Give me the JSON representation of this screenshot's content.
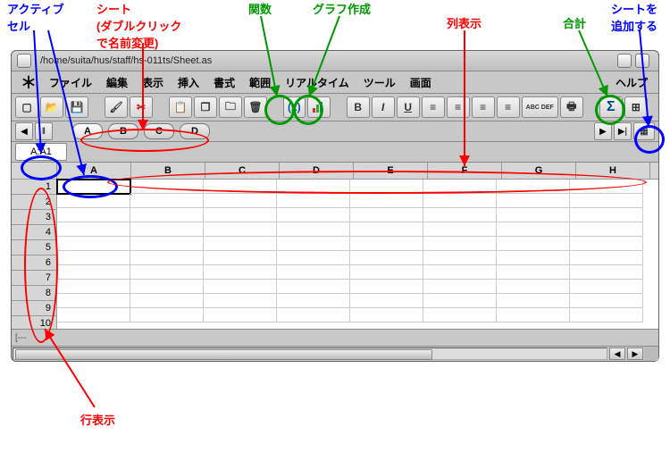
{
  "annotations": {
    "active_cell": "アクティブ\nセル",
    "sheet_rename": "シート\n(ダブルクリック\nで名前変更)",
    "function": "関数",
    "chart": "グラフ作成",
    "col_display": "列表示",
    "sum": "合計",
    "add_sheet": "シートを\n追加する",
    "row_display": "行表示"
  },
  "window": {
    "title": "/home/suita/hus/staff/hs-011ts/Sheet.as"
  },
  "menu": {
    "file": "ファイル",
    "edit": "編集",
    "view": "表示",
    "insert": "挿入",
    "format": "書式",
    "range": "範囲",
    "realtime": "リアルタイム",
    "tool": "ツール",
    "window": "画面",
    "help": "ヘルプ"
  },
  "toolbar": {
    "fx": "(x)",
    "chart": "▮",
    "bold": "B",
    "italic": "I",
    "underline": "U",
    "abc": "ABC\nDEF",
    "sigma": "Σ"
  },
  "sheets": {
    "a": "A",
    "b": "B",
    "c": "C",
    "d": "D"
  },
  "cellref": "A:A1",
  "columns": [
    "A",
    "B",
    "C",
    "D",
    "E",
    "F",
    "G",
    "H"
  ],
  "rows": [
    "1",
    "2",
    "3",
    "4",
    "5",
    "6",
    "7",
    "8",
    "9",
    "10"
  ],
  "status": "[---"
}
